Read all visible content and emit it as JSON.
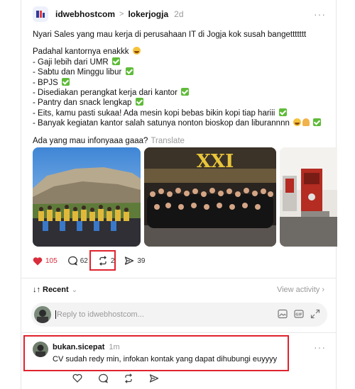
{
  "post": {
    "username": "idwebhostcom",
    "separator": ">",
    "community": "lokerjogja",
    "time": "2d",
    "lines": {
      "l1": "Nyari Sales yang mau kerja di perusahaan IT di Jogja kok susah bangettttttt",
      "l2": "Padahal kantornya enakkk",
      "l3": "- Gaji lebih dari UMR",
      "l4": "- Sabtu dan Minggu libur",
      "l5": "- BPJS",
      "l6": "- Disediakan perangkat kerja dari kantor",
      "l7": "- Pantry dan snack lengkap",
      "l8": "- Eits, kamu pasti sukaa! Ada mesin kopi bebas bikin kopi tiap hariii",
      "l9": "- Banyak kegiatan kantor salah satunya nonton bioskop dan liburannnn",
      "l10": "Ada yang mau infonyaaa gaaa?"
    },
    "translate": "Translate",
    "cinema_sign": "XXI",
    "counts": {
      "likes": "105",
      "comments": "62",
      "reposts": "2",
      "shares": "39"
    }
  },
  "replies_bar": {
    "sort_label": "Recent",
    "sort_icon": "↓↑",
    "view_activity": "View activity"
  },
  "reply_box": {
    "placeholder": "Reply to idwebhostcom..."
  },
  "comment": {
    "username": "bukan.sicepat",
    "time": "1m",
    "text": "CV sudah redy min, infokan kontak yang dapat dihubungi euyyyy"
  },
  "colors": {
    "like": "#d92c3c",
    "highlight": "#e0232e",
    "check": "#5fbb39"
  }
}
